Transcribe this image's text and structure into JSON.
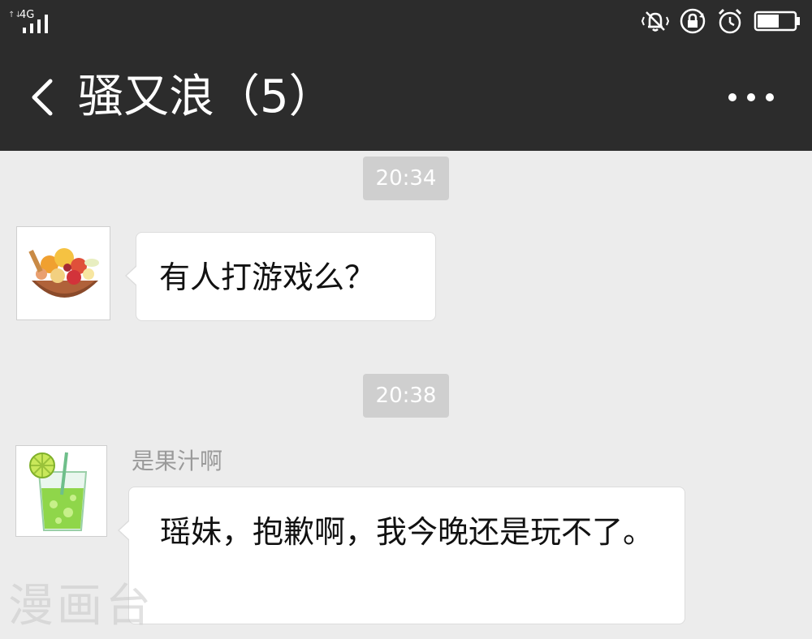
{
  "status_bar": {
    "network": "4G",
    "icons": [
      "vibrate-mute-icon",
      "rotation-lock-icon",
      "alarm-icon",
      "battery-icon"
    ]
  },
  "header": {
    "title": "骚又浪（5）",
    "back_icon": "chevron-left-icon",
    "more_icon": "more-dots-icon"
  },
  "messages": [
    {
      "timestamp": "20:34",
      "sender": "",
      "avatar": "fruit-basket-avatar",
      "text": "有人打游戏么？"
    },
    {
      "timestamp": "20:38",
      "sender": "是果汁啊",
      "avatar": "lime-juice-avatar",
      "text": "瑶妹，抱歉啊，我今晚还是玩不了。"
    }
  ],
  "watermark": "漫画台",
  "colors": {
    "header_bg": "#2c2c2c",
    "chat_bg": "#ececec",
    "bubble_bg": "#ffffff",
    "timestamp_bg": "#cfcfcf",
    "sender_name": "#9a9a9a"
  }
}
